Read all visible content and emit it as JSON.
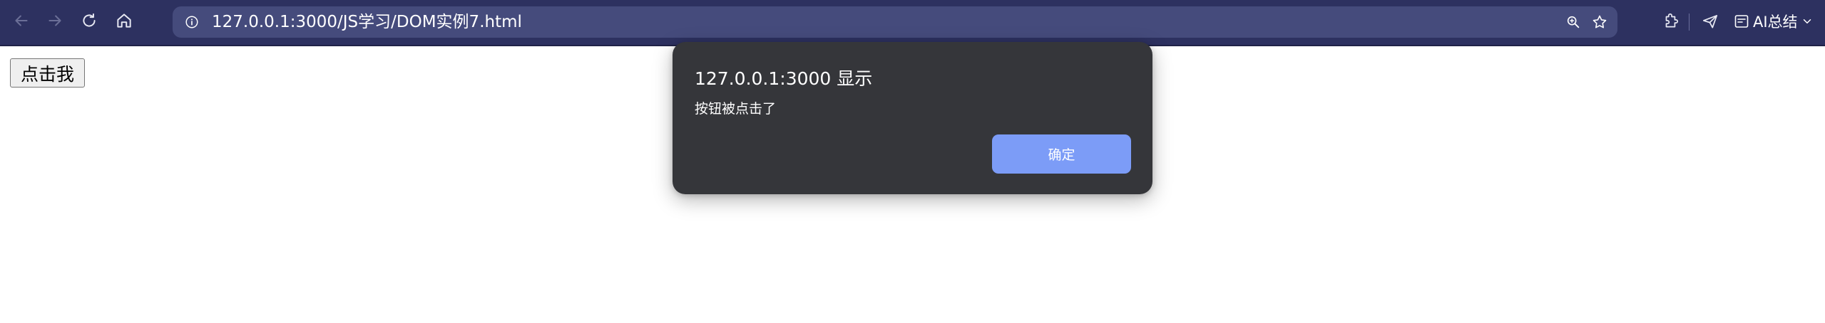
{
  "browser": {
    "url": "127.0.0.1:3000/JS学习/DOM实例7.html",
    "ai_summary_label": "AI总结",
    "icons": {
      "back": "back-arrow-icon",
      "forward": "forward-arrow-icon",
      "reload": "reload-icon",
      "home": "home-icon",
      "site_info": "info-icon",
      "zoom": "zoom-icon",
      "bookmark": "star-icon",
      "extensions": "puzzle-icon",
      "send": "send-icon",
      "ai_summary": "summary-icon",
      "chevron": "chevron-down-icon"
    },
    "colors": {
      "toolbar": "#2d3160",
      "address_bar": "#454b7c"
    }
  },
  "page": {
    "button_label": "点击我"
  },
  "dialog": {
    "title": "127.0.0.1:3000 显示",
    "message": "按钮被点击了",
    "ok_label": "确定",
    "colors": {
      "background": "#35363a",
      "ok_button": "#7c9cf7"
    }
  }
}
